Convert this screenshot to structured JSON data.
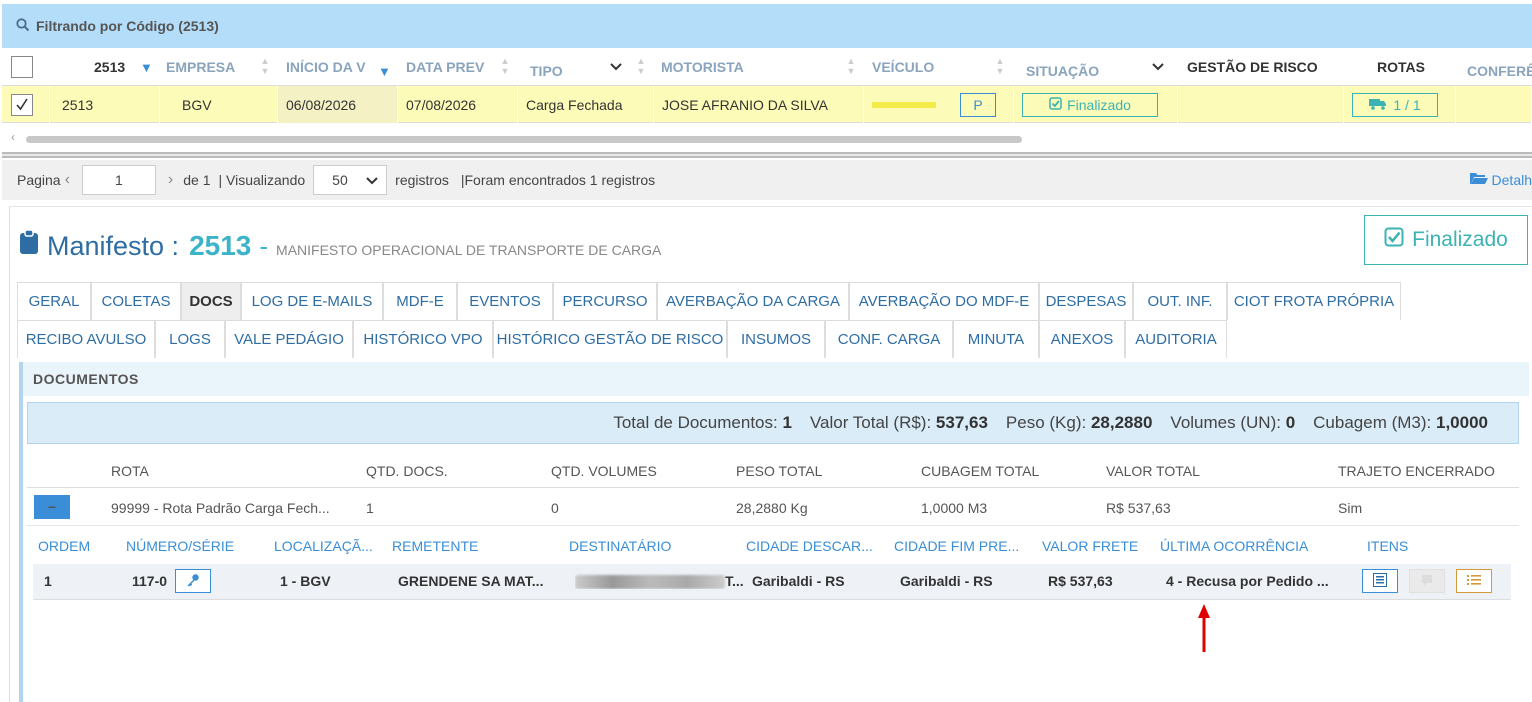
{
  "filter": {
    "label": "Filtrando por Código (2513)"
  },
  "grid": {
    "headers": {
      "code": "2513",
      "empresa": "EMPRESA",
      "inicio": "INÍCIO DA V",
      "data_prev": "DATA PREV",
      "tipo": "TIPO",
      "motorista": "MOTORISTA",
      "veiculo": "VEÍCULO",
      "situacao": "SITUAÇÃO",
      "gestao": "GESTÃO DE RISCO",
      "rotas": "ROTAS",
      "confer": "CONFERÊ"
    },
    "row": {
      "code": "2513",
      "empresa": "BGV",
      "inicio": "06/08/2026",
      "data_prev": "07/08/2026",
      "tipo": "Carga Fechada",
      "motorista": "JOSE AFRANIO DA SILVA",
      "veiculo_badge": "P",
      "situacao": "Finalizado",
      "rotas": "1 / 1"
    }
  },
  "pager": {
    "pagina_label": "Pagina",
    "page": "1",
    "of_label": "de 1",
    "visualizando_label": "| Visualizando",
    "page_size": "50",
    "registros_label": "registros",
    "found_label": "|Foram encontrados 1 registros",
    "detail_link": "Detalh"
  },
  "manifesto": {
    "title": "Manifesto :",
    "number": "2513",
    "dash": "-",
    "subtitle": "MANIFESTO OPERACIONAL DE TRANSPORTE DE CARGA",
    "status": "Finalizado"
  },
  "tabs": {
    "row1": [
      "GERAL",
      "COLETAS",
      "DOCS",
      "LOG DE E-MAILS",
      "MDF-E",
      "EVENTOS",
      "PERCURSO",
      "AVERBAÇÃO DA CARGA",
      "AVERBAÇÃO DO MDF-E",
      "DESPESAS",
      "OUT. INF.",
      "CIOT FROTA PRÓPRIA"
    ],
    "row2": [
      "RECIBO AVULSO",
      "LOGS",
      "VALE PEDÁGIO",
      "HISTÓRICO VPO",
      "HISTÓRICO GESTÃO DE RISCO",
      "INSUMOS",
      "CONF. CARGA",
      "MINUTA",
      "ANEXOS",
      "AUDITORIA"
    ]
  },
  "documentos": {
    "header": "DOCUMENTOS",
    "totals": {
      "docs_label": "Total de Documentos:",
      "docs_value": "1",
      "valor_label": "Valor Total (R$):",
      "valor_value": "537,63",
      "peso_label": "Peso (Kg):",
      "peso_value": "28,2880",
      "volumes_label": "Volumes (UN):",
      "volumes_value": "0",
      "cubagem_label": "Cubagem (M3):",
      "cubagem_value": "1,0000"
    },
    "route_headers": [
      "ROTA",
      "QTD. DOCS.",
      "QTD. VOLUMES",
      "PESO TOTAL",
      "CUBAGEM TOTAL",
      "VALOR TOTAL",
      "TRAJETO ENCERRADO"
    ],
    "route_row": {
      "rota": "99999 - Rota Padrão Carga Fech...",
      "qtd_docs": "1",
      "qtd_volumes": "0",
      "peso": "28,2880 Kg",
      "cubagem": "1,0000 M3",
      "valor": "R$ 537,63",
      "trajeto": "Sim"
    },
    "item_headers": [
      "ORDEM",
      "NÚMERO/SÉRIE",
      "LOCALIZAÇÃ...",
      "REMETENTE",
      "DESTINATÁRIO",
      "CIDADE DESCAR...",
      "CIDADE FIM PRE...",
      "VALOR FRETE",
      "ÚLTIMA OCORRÊNCIA",
      "ITENS"
    ],
    "item_row": {
      "ordem": "1",
      "numero": "117-0",
      "localizacao": "1 - BGV",
      "remetente": "GRENDENE SA MAT...",
      "destinatario_suffix": "T...",
      "cidade_descarga": "Garibaldi - RS",
      "cidade_fim": "Garibaldi - RS",
      "valor_frete": "R$ 537,63",
      "ocorrencia": "4 - Recusa por Pedido ..."
    }
  },
  "colors": {
    "accent": "#3a8ed8",
    "teal": "#3bb3b3",
    "filter_bg": "#b3ddf9",
    "row_selected": "#fcfcb8",
    "arrow": "#e00000"
  }
}
